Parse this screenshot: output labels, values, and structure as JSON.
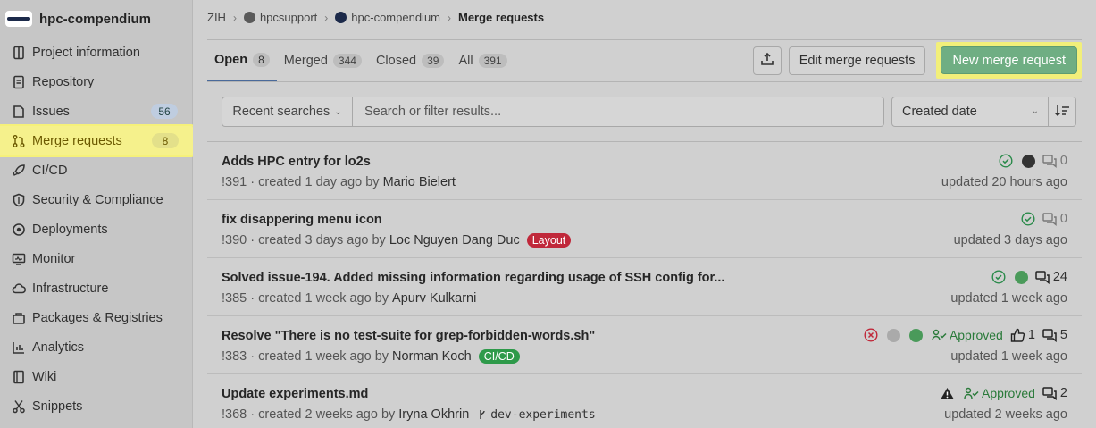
{
  "project": {
    "name": "hpc-compendium"
  },
  "sidebar": {
    "items": [
      {
        "label": "Project information",
        "icon": "project-icon"
      },
      {
        "label": "Repository",
        "icon": "repository-icon"
      },
      {
        "label": "Issues",
        "icon": "issues-icon",
        "badge": "56"
      },
      {
        "label": "Merge requests",
        "icon": "merge-request-icon",
        "badge": "8",
        "active": true
      },
      {
        "label": "CI/CD",
        "icon": "rocket-icon"
      },
      {
        "label": "Security & Compliance",
        "icon": "shield-icon"
      },
      {
        "label": "Deployments",
        "icon": "deployments-icon"
      },
      {
        "label": "Monitor",
        "icon": "monitor-icon"
      },
      {
        "label": "Infrastructure",
        "icon": "cloud-icon"
      },
      {
        "label": "Packages & Registries",
        "icon": "package-icon"
      },
      {
        "label": "Analytics",
        "icon": "chart-icon"
      },
      {
        "label": "Wiki",
        "icon": "book-icon"
      },
      {
        "label": "Snippets",
        "icon": "snippet-icon"
      }
    ]
  },
  "breadcrumb": {
    "items": [
      "ZIH",
      "hpcsupport",
      "hpc-compendium",
      "Merge requests"
    ]
  },
  "tabs": [
    {
      "label": "Open",
      "count": "8"
    },
    {
      "label": "Merged",
      "count": "344"
    },
    {
      "label": "Closed",
      "count": "39"
    },
    {
      "label": "All",
      "count": "391"
    }
  ],
  "actions": {
    "export_icon": "export-icon",
    "edit_label": "Edit merge requests",
    "new_label": "New merge request"
  },
  "filter": {
    "recent_label": "Recent searches",
    "search_placeholder": "Search or filter results...",
    "sort_label": "Created date",
    "sort_direction_icon": "sort-descending-icon"
  },
  "merge_requests": [
    {
      "title": "Adds HPC entry for lo2s",
      "id": "!391",
      "created": "created 1 day ago by",
      "author": "Mario Bielert",
      "updated": "updated 20 hours ago",
      "comments": "0"
    },
    {
      "title": "fix disappering menu icon",
      "id": "!390",
      "created": "created 3 days ago by",
      "author": "Loc Nguyen Dang Duc",
      "label": "Layout",
      "updated": "updated 3 days ago",
      "comments": "0"
    },
    {
      "title": "Solved issue-194. Added missing information regarding usage of SSH config for...",
      "id": "!385",
      "created": "created 1 week ago by",
      "author": "Apurv Kulkarni",
      "updated": "updated 1 week ago",
      "comments": "24"
    },
    {
      "title": "Resolve \"There is no test-suite for grep-forbidden-words.sh\"",
      "id": "!383",
      "created": "created 1 week ago by",
      "author": "Norman Koch",
      "label": "CI/CD",
      "approved": "Approved",
      "likes": "1",
      "updated": "updated 1 week ago",
      "comments": "5"
    },
    {
      "title": "Update experiments.md",
      "id": "!368",
      "created": "created 2 weeks ago by",
      "author": "Iryna Okhrin",
      "branch": "dev-experiments",
      "approved": "Approved",
      "updated": "updated 2 weeks ago",
      "comments": "2"
    }
  ],
  "colors": {
    "label_layout": "#c0283a",
    "label_cicd": "#2e9a4a",
    "new_button": "#6fae83",
    "highlight": "#f5f18c"
  }
}
